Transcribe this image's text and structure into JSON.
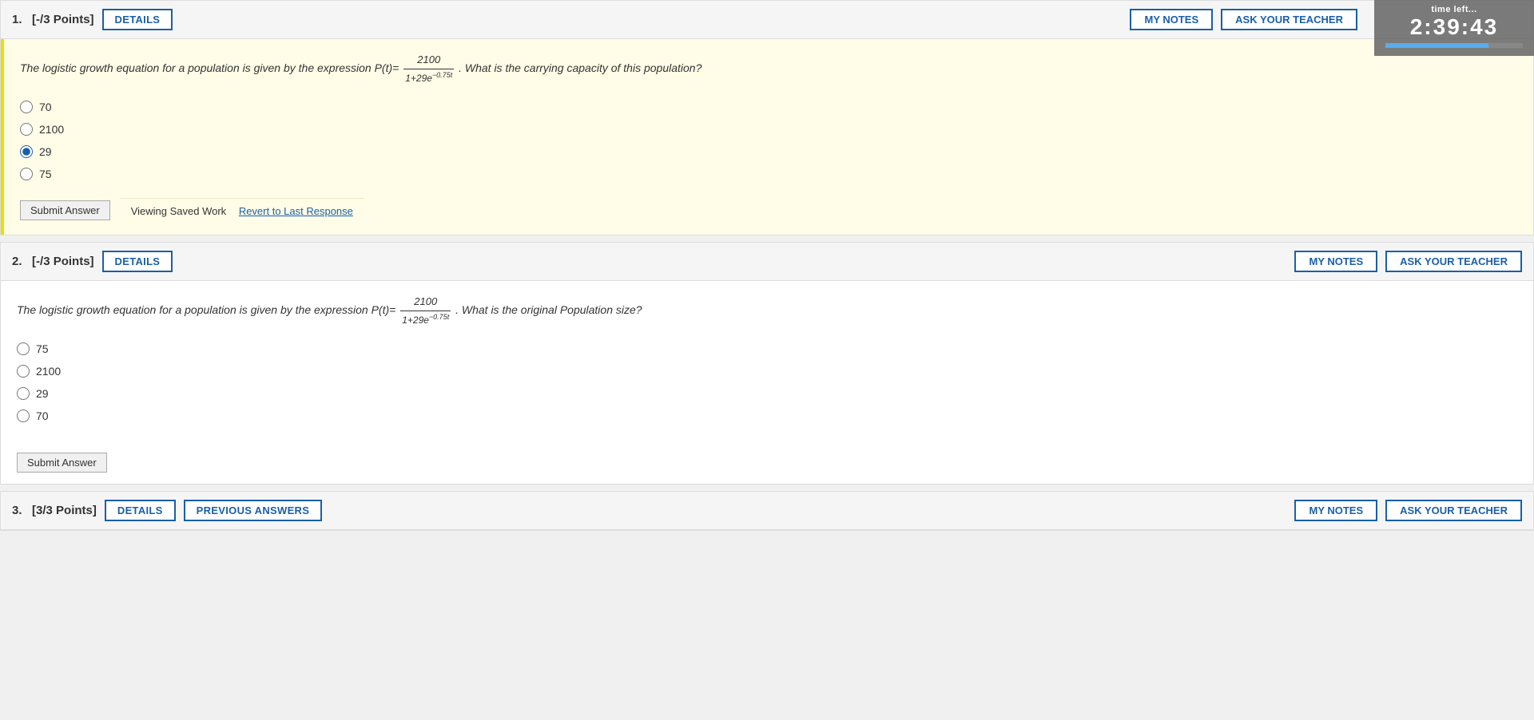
{
  "timer": {
    "label": "time left...",
    "value": "2:39:43"
  },
  "questions": [
    {
      "number": "1.",
      "points": "[-/3 Points]",
      "details_label": "DETAILS",
      "my_notes_label": "MY NOTES",
      "ask_teacher_label": "ASK YOUR TEACHER",
      "question_text_prefix": "The logistic growth equation for a population is given by the expression P(t)=",
      "question_fraction_num": "2100",
      "question_fraction_den": "1+29e",
      "question_exponent": "−0.75t",
      "question_text_suffix": ". What is the carrying capacity of this population?",
      "options": [
        "70",
        "2100",
        "29",
        "75"
      ],
      "selected_index": 2,
      "saved_work_text": "Viewing Saved Work",
      "revert_text": "Revert to Last Response",
      "submit_label": "Submit Answer"
    },
    {
      "number": "2.",
      "points": "[-/3 Points]",
      "details_label": "DETAILS",
      "my_notes_label": "MY NOTES",
      "ask_teacher_label": "ASK YOUR TEACHER",
      "question_text_prefix": "The logistic growth equation for a population is given by the expression P(t)=",
      "question_fraction_num": "2100",
      "question_fraction_den": "1+29e",
      "question_exponent": "−0.75t",
      "question_text_suffix": ". What is the original Population size?",
      "options": [
        "75",
        "2100",
        "29",
        "70"
      ],
      "selected_index": -1,
      "submit_label": "Submit Answer"
    },
    {
      "number": "3.",
      "points": "[3/3 Points]",
      "details_label": "DETAILS",
      "prev_answers_label": "PREVIOUS ANSWERS",
      "my_notes_label": "MY NOTES",
      "ask_teacher_label": "ASK YOUR TEACHER"
    }
  ]
}
